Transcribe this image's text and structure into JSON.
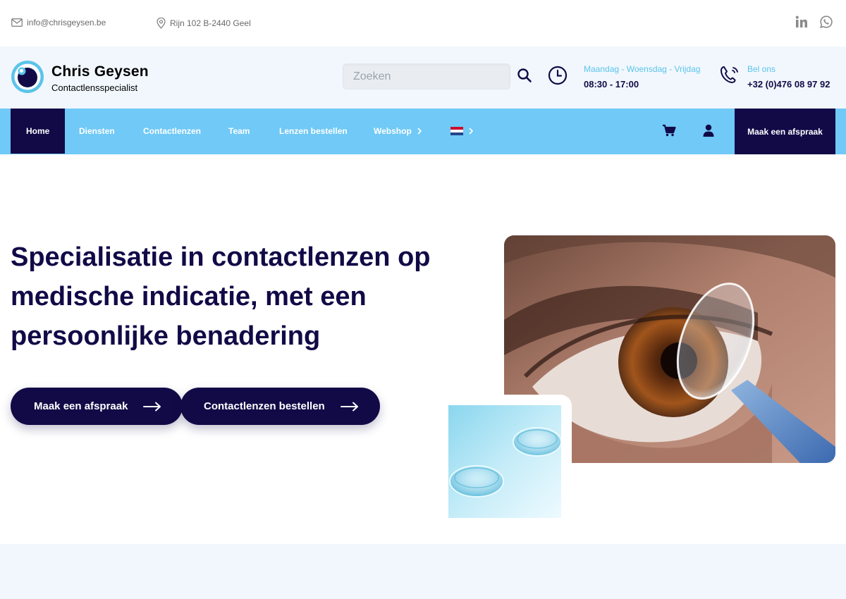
{
  "topbar": {
    "email": "info@chrisgeysen.be",
    "address": "Rijn 102 B-2440 Geel",
    "social": [
      "linkedin-icon",
      "whatsapp-icon"
    ]
  },
  "header": {
    "brand_name": "Chris Geysen",
    "brand_sub": "Contactlensspecialist",
    "search_placeholder": "Zoeken",
    "hours_label": "Maandag - Woensdag - Vrijdag",
    "hours_value": "08:30 - 17:00",
    "call_label": "Bel ons",
    "call_value": "+32 (0)476 08 97 92"
  },
  "nav": {
    "items": [
      {
        "label": "Home",
        "active": true
      },
      {
        "label": "Diensten"
      },
      {
        "label": "Contactlenzen"
      },
      {
        "label": "Team"
      },
      {
        "label": "Lenzen bestellen"
      },
      {
        "label": "Webshop"
      }
    ],
    "language": "nl-flag-icon",
    "cta": "Maak een afspraak"
  },
  "hero": {
    "title": "Specialisatie in contactlenzen op medische indicatie, met een persoonlijke benadering",
    "btn_primary": "Maak een afspraak",
    "btn_secondary": "Contactlenzen bestellen"
  },
  "colors": {
    "navy": "#120a47",
    "sky": "#70c9f6",
    "accent_text": "#5bc4ea",
    "header_bg": "#f1f7fd"
  }
}
